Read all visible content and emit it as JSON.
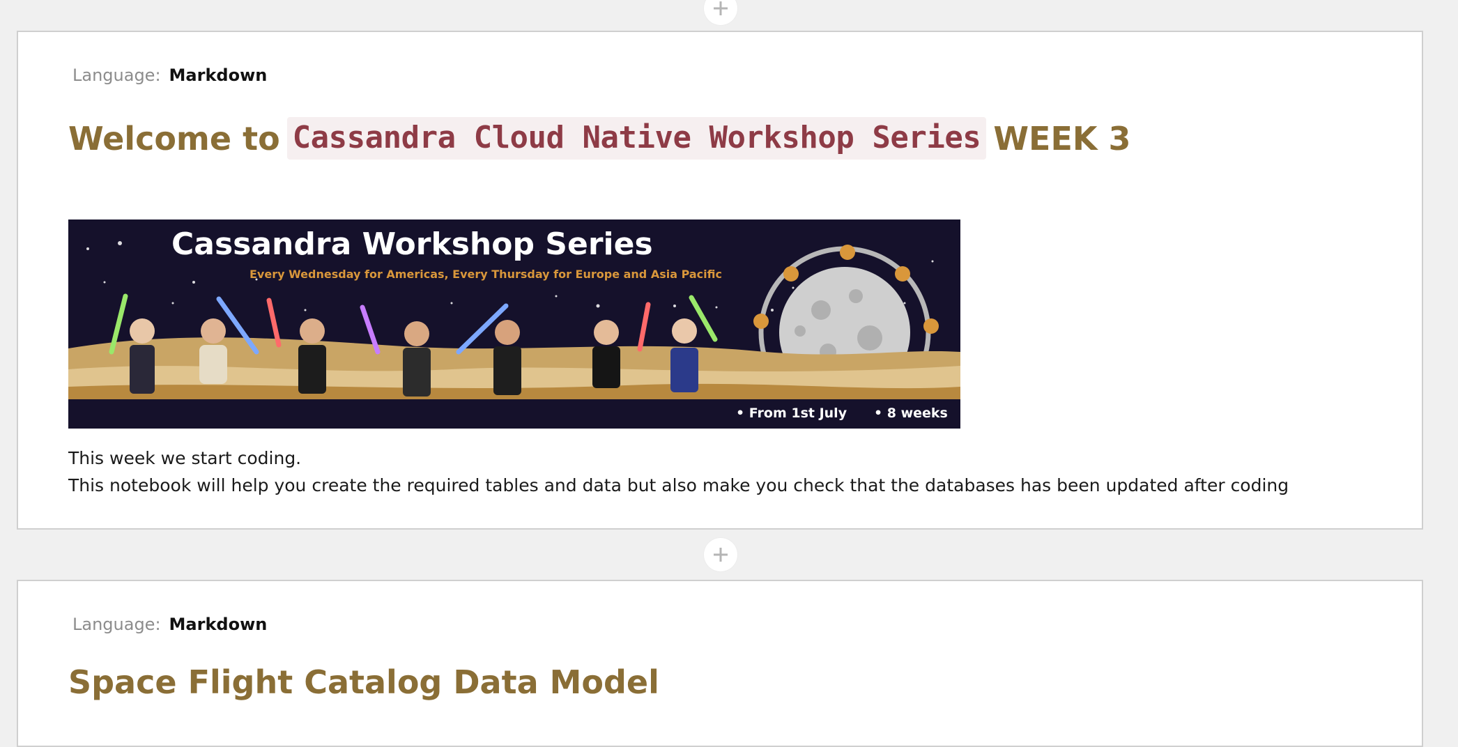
{
  "cells": [
    {
      "language_label": "Language:",
      "language_value": "Markdown",
      "heading_prefix": "Welcome to",
      "heading_code": "Cassandra Cloud Native Workshop Series",
      "heading_suffix": "WEEK 3",
      "banner": {
        "title": "Cassandra Workshop Series",
        "subtitle": "Every Wednesday for Americas, Every Thursday for Europe and Asia Pacific",
        "note_start": "• From 1st July",
        "note_weeks": "• 8 weeks"
      },
      "paragraphs": [
        "This week we start coding.",
        "This notebook will help you create the required tables and data but also make you check that the databases has been updated after coding"
      ]
    },
    {
      "language_label": "Language:",
      "language_value": "Markdown",
      "heading": "Space Flight Catalog Data Model"
    }
  ],
  "colors": {
    "heading": "#8a6e36",
    "inline_code": "#8e3b46",
    "inline_code_bg": "#f6eff0",
    "banner_bg": "#15112b",
    "banner_accent": "#d9973b",
    "page_bg": "#f0f0f0"
  },
  "icons": {
    "add_cell": "plus-icon"
  }
}
